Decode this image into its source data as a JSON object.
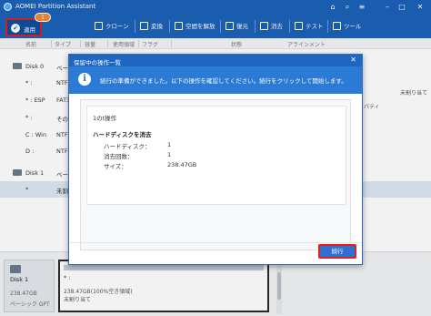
{
  "app": {
    "title": "AOMEI Partition Assistant"
  },
  "toolbar": {
    "apply_label": "適用",
    "pending_badge": "1",
    "items": [
      "クローン",
      "変換",
      "空間を解放",
      "復元",
      "消去",
      "テスト",
      "ツール"
    ]
  },
  "columns": [
    "名前",
    "タイプ",
    "容量",
    "使用領域",
    "フラグ",
    "状態",
    "アラインメント"
  ],
  "partitions": [
    {
      "name": "Disk 0",
      "type": "ベーシ"
    },
    {
      "name": "* :",
      "type": "NTFS"
    },
    {
      "name": "* : ESP",
      "type": "FAT32"
    },
    {
      "name": "* :",
      "type": "その他"
    },
    {
      "name": "C : Win",
      "type": "NTFS"
    },
    {
      "name": "D :",
      "type": "NTFS"
    },
    {
      "name": "Disk 1",
      "type": "ベーシ"
    },
    {
      "name": "*",
      "type": "未割り当"
    }
  ],
  "right_panel": {
    "unallocated": "未割り当て",
    "property": "パティ"
  },
  "dialog": {
    "title": "保留中の操作一覧",
    "message": "続行の準備ができました。以下の操作を確認してください。続行をクリックして開始します。",
    "operation_count": "1のt操作",
    "operation_header": "ハードディスクを消去",
    "details": [
      {
        "label": "ハードディスク：",
        "value": "1"
      },
      {
        "label": "消去回数：",
        "value": "1"
      },
      {
        "label": "サイズ：",
        "value": "238.47GB"
      }
    ],
    "continue_label": "続行"
  },
  "bottom": {
    "disk_name": "Disk 1",
    "disk_size": "238.47GB",
    "disk_style": "ベーシック GPT",
    "partition_name": "* :",
    "partition_info": "238.47GB(100%空き領域)",
    "partition_type": "未割り当て"
  },
  "colors": {
    "titlebar": "#1c63b8",
    "accent": "#2f6fd0",
    "highlight": "#e02020",
    "badge": "#f08a35"
  }
}
